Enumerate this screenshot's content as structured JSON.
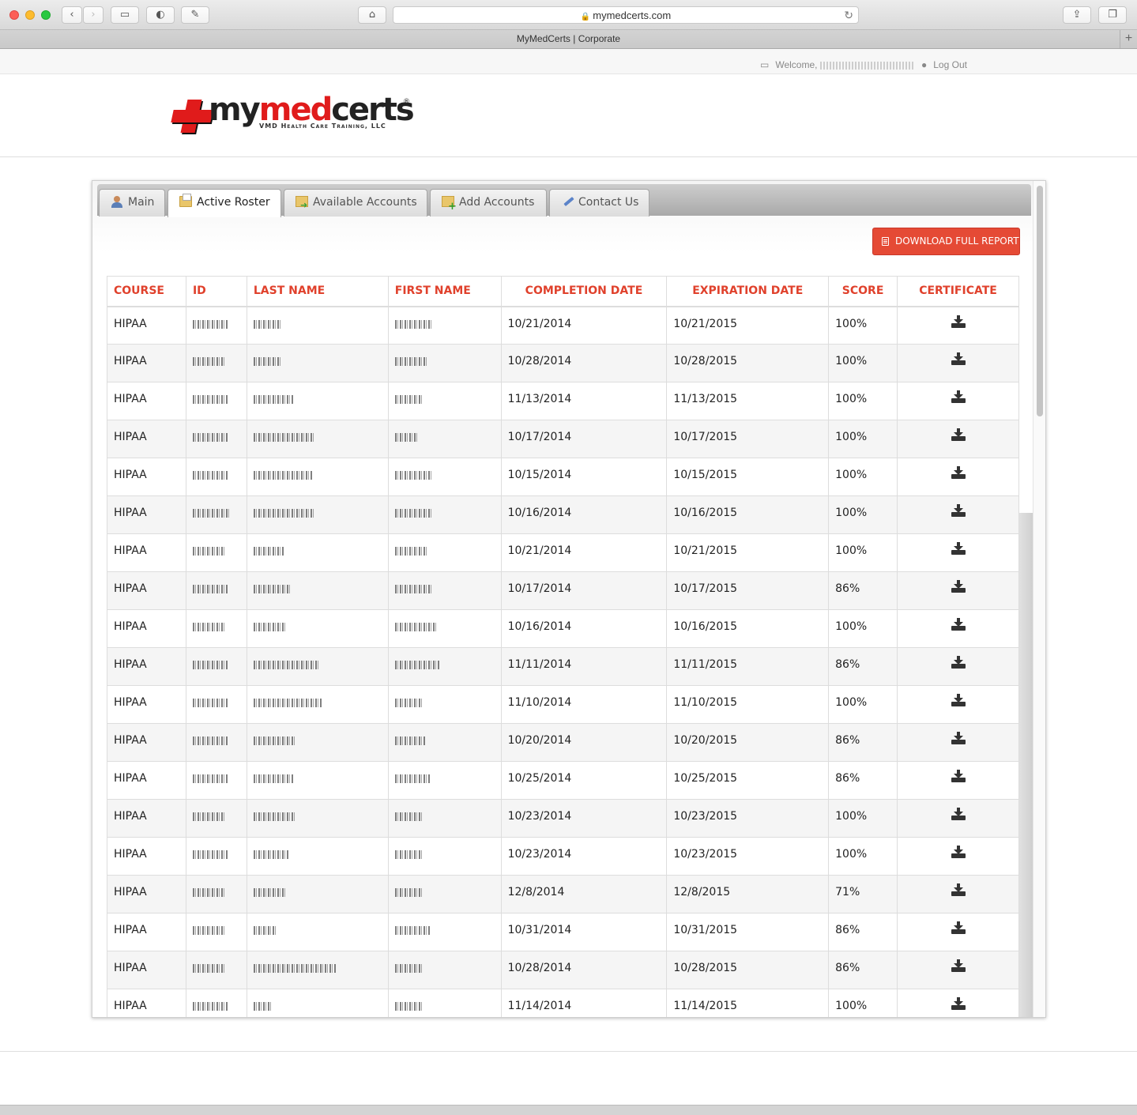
{
  "browser": {
    "url": "mymedcerts.com",
    "tab_title": "MyMedCerts | Corporate"
  },
  "userbar": {
    "welcome": "Welcome,",
    "logout": "Log Out"
  },
  "logo": {
    "word_dark_1": "my",
    "word_red": "med",
    "word_dark_2": "certs",
    "subtitle": "VMD Health Care Training, LLC"
  },
  "tabs": [
    {
      "label": "Main",
      "icon": "user-icon"
    },
    {
      "label": "Active Roster",
      "icon": "folder-icon",
      "active": true
    },
    {
      "label": "Available Accounts",
      "icon": "folder-arrow-icon"
    },
    {
      "label": "Add Accounts",
      "icon": "folder-add-icon"
    },
    {
      "label": "Contact Us",
      "icon": "pen-icon"
    }
  ],
  "download_button": "DOWNLOAD FULL REPORT",
  "table": {
    "headers": [
      "COURSE",
      "ID",
      "LAST NAME",
      "FIRST NAME",
      "COMPLETION DATE",
      "EXPIRATION DATE",
      "SCORE",
      "CERTIFICATE"
    ],
    "rows": [
      {
        "course": "HIPAA",
        "completion": "10/21/2014",
        "expiration": "10/21/2015",
        "score": "100%"
      },
      {
        "course": "HIPAA",
        "completion": "10/28/2014",
        "expiration": "10/28/2015",
        "score": "100%"
      },
      {
        "course": "HIPAA",
        "completion": "11/13/2014",
        "expiration": "11/13/2015",
        "score": "100%"
      },
      {
        "course": "HIPAA",
        "completion": "10/17/2014",
        "expiration": "10/17/2015",
        "score": "100%"
      },
      {
        "course": "HIPAA",
        "completion": "10/15/2014",
        "expiration": "10/15/2015",
        "score": "100%"
      },
      {
        "course": "HIPAA",
        "completion": "10/16/2014",
        "expiration": "10/16/2015",
        "score": "100%"
      },
      {
        "course": "HIPAA",
        "completion": "10/21/2014",
        "expiration": "10/21/2015",
        "score": "100%"
      },
      {
        "course": "HIPAA",
        "completion": "10/17/2014",
        "expiration": "10/17/2015",
        "score": "86%"
      },
      {
        "course": "HIPAA",
        "completion": "10/16/2014",
        "expiration": "10/16/2015",
        "score": "100%"
      },
      {
        "course": "HIPAA",
        "completion": "11/11/2014",
        "expiration": "11/11/2015",
        "score": "86%"
      },
      {
        "course": "HIPAA",
        "completion": "11/10/2014",
        "expiration": "11/10/2015",
        "score": "100%"
      },
      {
        "course": "HIPAA",
        "completion": "10/20/2014",
        "expiration": "10/20/2015",
        "score": "86%"
      },
      {
        "course": "HIPAA",
        "completion": "10/25/2014",
        "expiration": "10/25/2015",
        "score": "86%"
      },
      {
        "course": "HIPAA",
        "completion": "10/23/2014",
        "expiration": "10/23/2015",
        "score": "100%"
      },
      {
        "course": "HIPAA",
        "completion": "10/23/2014",
        "expiration": "10/23/2015",
        "score": "100%"
      },
      {
        "course": "HIPAA",
        "completion": "12/8/2014",
        "expiration": "12/8/2015",
        "score": "71%"
      },
      {
        "course": "HIPAA",
        "completion": "10/31/2014",
        "expiration": "10/31/2015",
        "score": "86%"
      },
      {
        "course": "HIPAA",
        "completion": "10/28/2014",
        "expiration": "10/28/2015",
        "score": "86%"
      },
      {
        "course": "HIPAA",
        "completion": "11/14/2014",
        "expiration": "11/14/2015",
        "score": "100%"
      }
    ]
  }
}
